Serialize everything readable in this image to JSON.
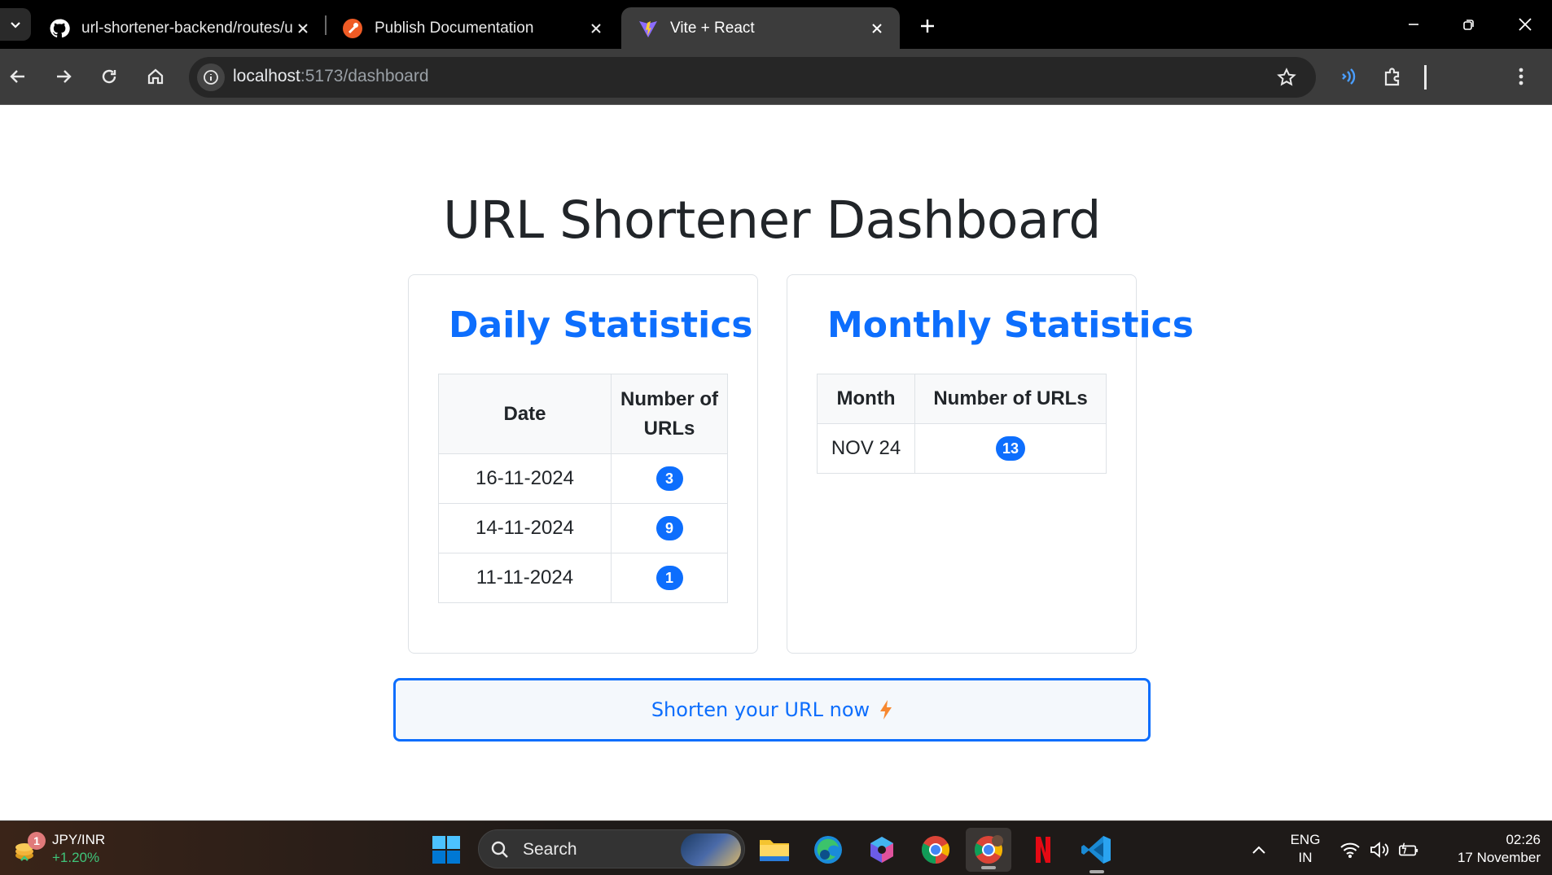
{
  "browser": {
    "tabs": [
      {
        "title": "url-shortener-backend/routes/u",
        "icon": "github-icon",
        "active": false
      },
      {
        "title": "Publish Documentation",
        "icon": "postman-icon",
        "active": false
      },
      {
        "title": "Vite + React",
        "icon": "vite-icon",
        "active": true
      }
    ],
    "url_host": "localhost",
    "url_path": ":5173/dashboard"
  },
  "page": {
    "title": "URL Shortener Dashboard",
    "daily": {
      "heading": "Daily Statistics",
      "col_date": "Date",
      "col_count": "Number of URLs",
      "rows": [
        {
          "date": "16-11-2024",
          "count": "3"
        },
        {
          "date": "14-11-2024",
          "count": "9"
        },
        {
          "date": "11-11-2024",
          "count": "1"
        }
      ]
    },
    "monthly": {
      "heading": "Monthly Statistics",
      "col_month": "Month",
      "col_count": "Number of URLs",
      "rows": [
        {
          "month": "NOV 24",
          "count": "13"
        }
      ]
    },
    "cta_label": "Shorten your URL now",
    "accent_color": "#0d6efd",
    "bolt_color": "#f7882f"
  },
  "taskbar": {
    "widget_name": "JPY/INR",
    "widget_change": "+1.20%",
    "widget_badge": "1",
    "search_placeholder": "Search",
    "lang_top": "ENG",
    "lang_bottom": "IN",
    "time": "02:26",
    "date": "17 November"
  }
}
